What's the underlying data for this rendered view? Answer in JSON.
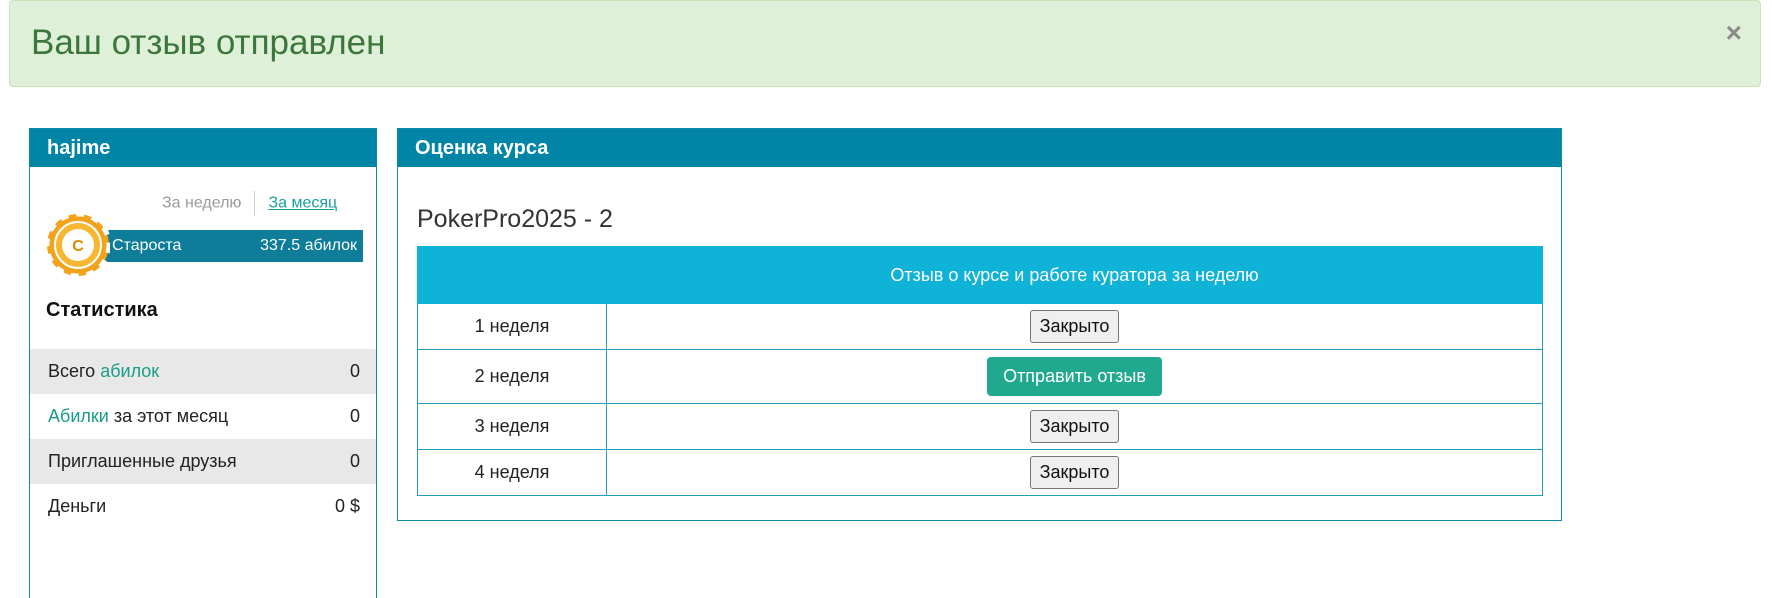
{
  "alert": {
    "message": "Ваш отзыв отправлен",
    "close_label": "×"
  },
  "profile": {
    "username": "hajime",
    "tabs": {
      "week": "За неделю",
      "month": "За месяц"
    },
    "rank": {
      "badge_letter": "C",
      "name": "Староста",
      "points": "337.5 абилок"
    },
    "stats_title": "Статистика",
    "stats": [
      {
        "label_prefix": "Всего ",
        "label_link": "абилок",
        "label_suffix": "",
        "value": "0"
      },
      {
        "label_prefix": "",
        "label_link": "Абилки",
        "label_suffix": " за этот месяц",
        "value": "0"
      },
      {
        "label_prefix": "Приглашенные друзья",
        "label_link": "",
        "label_suffix": "",
        "value": "0"
      },
      {
        "label_prefix": "Деньги",
        "label_link": "",
        "label_suffix": "",
        "value": "0 $"
      }
    ]
  },
  "course": {
    "panel_title": "Оценка курса",
    "title": "PokerPro2025 - 2",
    "table_header": {
      "week_col": "",
      "feedback_col": "Отзыв о курсе и работе куратора за неделю"
    },
    "rows": [
      {
        "week": "1 неделя",
        "action": "Закрыто"
      },
      {
        "week": "2 неделя",
        "action": "Отправить отзыв"
      },
      {
        "week": "3 неделя",
        "action": "Закрыто"
      },
      {
        "week": "4 неделя",
        "action": "Закрыто"
      }
    ]
  },
  "colors": {
    "panel_header": "#0085a6",
    "table_header": "#10b3d8",
    "send_button": "#21a98f",
    "alert_bg": "#dff0d8",
    "alert_text": "#3c763d",
    "link": "#1b9c88"
  }
}
